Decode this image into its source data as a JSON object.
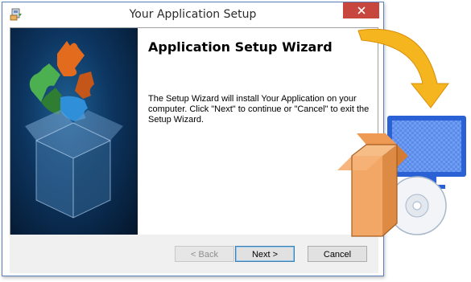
{
  "window": {
    "title": "Your Application Setup",
    "close_glyph": "✕"
  },
  "wizard": {
    "heading": "Application Setup Wizard",
    "description": "The Setup Wizard will install Your Application on your computer.  Click \"Next\" to continue or \"Cancel\" to exit the Setup Wizard."
  },
  "buttons": {
    "back": "< Back",
    "next": "Next >",
    "cancel": "Cancel"
  },
  "icons": {
    "app": "installer-icon",
    "close": "close-icon",
    "sidebar_art": "puzzle-box-illustration",
    "install_art": "box-to-monitor-illustration"
  },
  "colors": {
    "accent": "#3c7fb1",
    "close": "#c7463d",
    "sidebar": "#0d3560"
  }
}
